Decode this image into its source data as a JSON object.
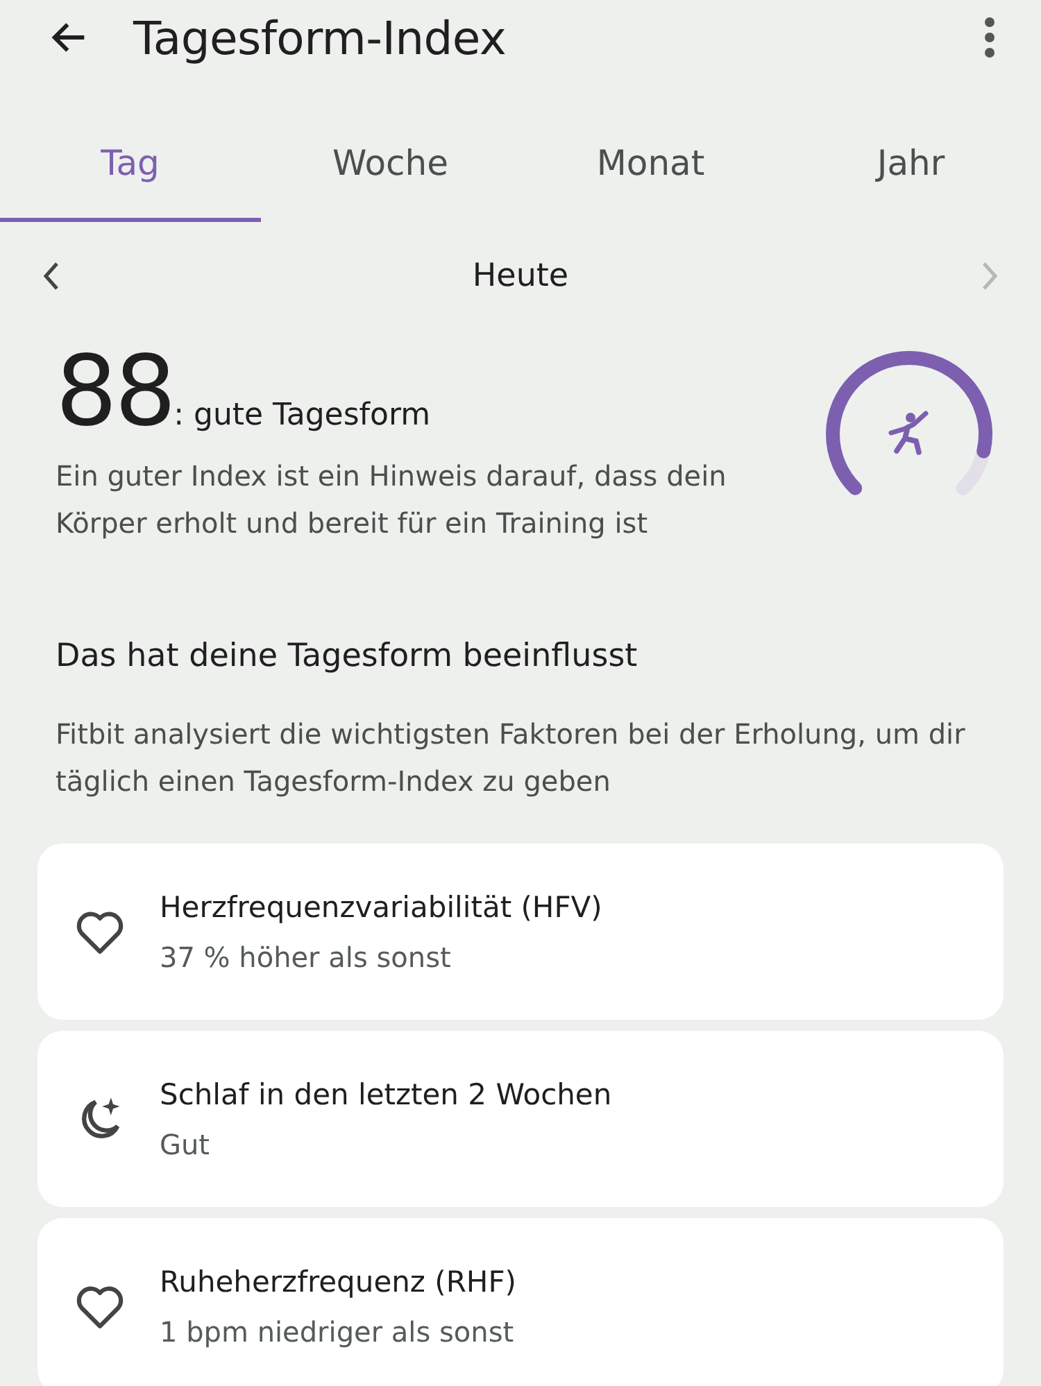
{
  "app_bar": {
    "title": "Tagesform-Index"
  },
  "tabs": [
    {
      "label": "Tag",
      "selected": true
    },
    {
      "label": "Woche",
      "selected": false
    },
    {
      "label": "Monat",
      "selected": false
    },
    {
      "label": "Jahr",
      "selected": false
    }
  ],
  "date_nav": {
    "label": "Heute",
    "previous_enabled": true,
    "next_enabled": false
  },
  "score": {
    "value": "88",
    "label": ": gute Tagesform",
    "description": "Ein guter Index ist ein Hinweis darauf, dass dein Körper erholt und bereit für ein Training ist",
    "level": 0.88
  },
  "section": {
    "title": "Das hat deine Tagesform beeinflusst",
    "description": "Fitbit analysiert die wichtigsten Faktoren bei der Erholung, um dir täglich einen Tagesform-Index zu geben"
  },
  "factors": [
    {
      "kind": "heart",
      "title": "Herzfrequenzvariabilität (HFV)",
      "detail": "37 % höher als sonst"
    },
    {
      "kind": "sleep",
      "title": "Schlaf in den letzten 2 Wochen",
      "detail": "Gut"
    },
    {
      "kind": "heart",
      "title": "Ruheherzfrequenz (RHF)",
      "detail": "1 bpm niedriger als sonst"
    }
  ]
}
